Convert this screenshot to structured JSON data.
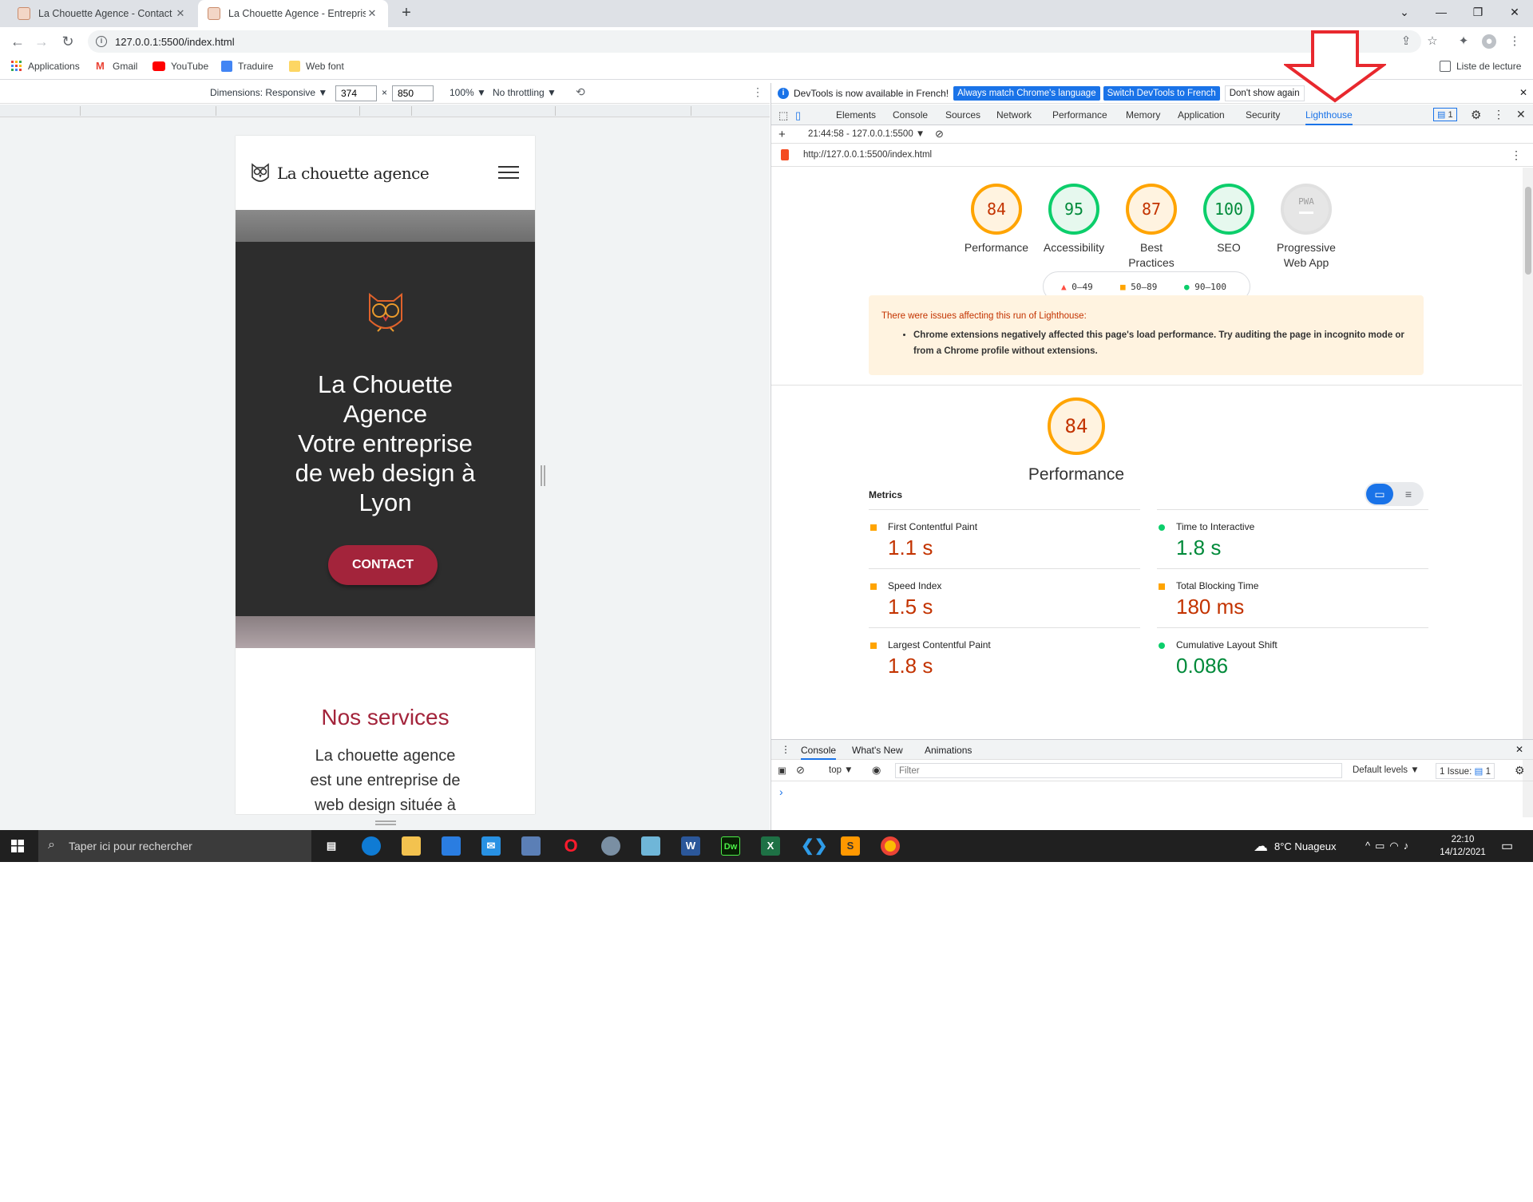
{
  "browser": {
    "tabs": [
      {
        "title": "La Chouette Agence - Contact"
      },
      {
        "title": "La Chouette Agence - Entreprise"
      }
    ],
    "url": "127.0.0.1:5500/index.html",
    "bookmarks": [
      "Applications",
      "Gmail",
      "YouTube",
      "Traduire",
      "Web font"
    ],
    "reading_list": "Liste de lecture"
  },
  "device_toolbar": {
    "dimensions": "Dimensions: Responsive ▼",
    "width": "374",
    "times": "×",
    "height": "850",
    "zoom": "100% ▼",
    "throttling": "No throttling ▼"
  },
  "mobile_site": {
    "brand": "La chouette agence",
    "hero_title_lines": [
      "La Chouette",
      "Agence",
      "Votre entreprise",
      "de web design à",
      "Lyon"
    ],
    "cta": "CONTACT",
    "section_title": "Nos services",
    "section_text_lines": [
      "La chouette agence",
      "est une entreprise de",
      "web design située à"
    ]
  },
  "devtools": {
    "infobar": {
      "text": "DevTools is now available in French!",
      "btn_match": "Always match Chrome's language",
      "btn_switch": "Switch DevTools to French",
      "btn_dismiss": "Don't show again"
    },
    "tabs": [
      "Elements",
      "Console",
      "Sources",
      "Network",
      "Performance",
      "Memory",
      "Application",
      "Security",
      "Lighthouse"
    ],
    "issues_badge": "1",
    "lighthouse": {
      "run": "21:44:58 - 127.0.0.1:5500 ▼",
      "url": "http://127.0.0.1:5500/index.html",
      "scores": [
        {
          "value": "84",
          "label_lines": [
            "Performance"
          ],
          "status": "average"
        },
        {
          "value": "95",
          "label_lines": [
            "Accessibility"
          ],
          "status": "pass"
        },
        {
          "value": "87",
          "label_lines": [
            "Best",
            "Practices"
          ],
          "status": "average"
        },
        {
          "value": "100",
          "label_lines": [
            "SEO"
          ],
          "status": "pass"
        },
        {
          "value": "PWA",
          "label_lines": [
            "Progressive",
            "Web App"
          ],
          "status": "na"
        }
      ],
      "legend": [
        "0–49",
        "50–89",
        "90–100"
      ],
      "warning_title": "There were issues affecting this run of Lighthouse:",
      "warning_items": [
        "Chrome extensions negatively affected this page's load performance. Try auditing the page in incognito mode or from a Chrome profile without extensions."
      ],
      "perf_score": "84",
      "perf_title": "Performance",
      "metrics_heading": "Metrics",
      "metrics": [
        {
          "name": "First Contentful Paint",
          "value": "1.1 s",
          "status": "average"
        },
        {
          "name": "Time to Interactive",
          "value": "1.8 s",
          "status": "pass"
        },
        {
          "name": "Speed Index",
          "value": "1.5 s",
          "status": "average"
        },
        {
          "name": "Total Blocking Time",
          "value": "180 ms",
          "status": "average"
        },
        {
          "name": "Largest Contentful Paint",
          "value": "1.8 s",
          "status": "average"
        },
        {
          "name": "Cumulative Layout Shift",
          "value": "0.086",
          "status": "pass"
        }
      ]
    },
    "drawer": {
      "tabs": [
        "Console",
        "What's New",
        "Animations"
      ],
      "context": "top ▼",
      "filter_placeholder": "Filter",
      "levels": "Default levels ▼",
      "issues": "1 Issue:",
      "issues_count": "1",
      "prompt": "›"
    }
  },
  "taskbar": {
    "search_placeholder": "Taper ici pour rechercher",
    "weather": "8°C  Nuageux",
    "time": "22:10",
    "date": "14/12/2021"
  },
  "colors": {
    "accent_blue": "#1a73e8",
    "score_average": "#ffa400",
    "score_pass": "#0cce6b",
    "score_fail": "#ff4e42",
    "brand_red": "#a3243b",
    "annotation_arrow": "#e8282e"
  }
}
